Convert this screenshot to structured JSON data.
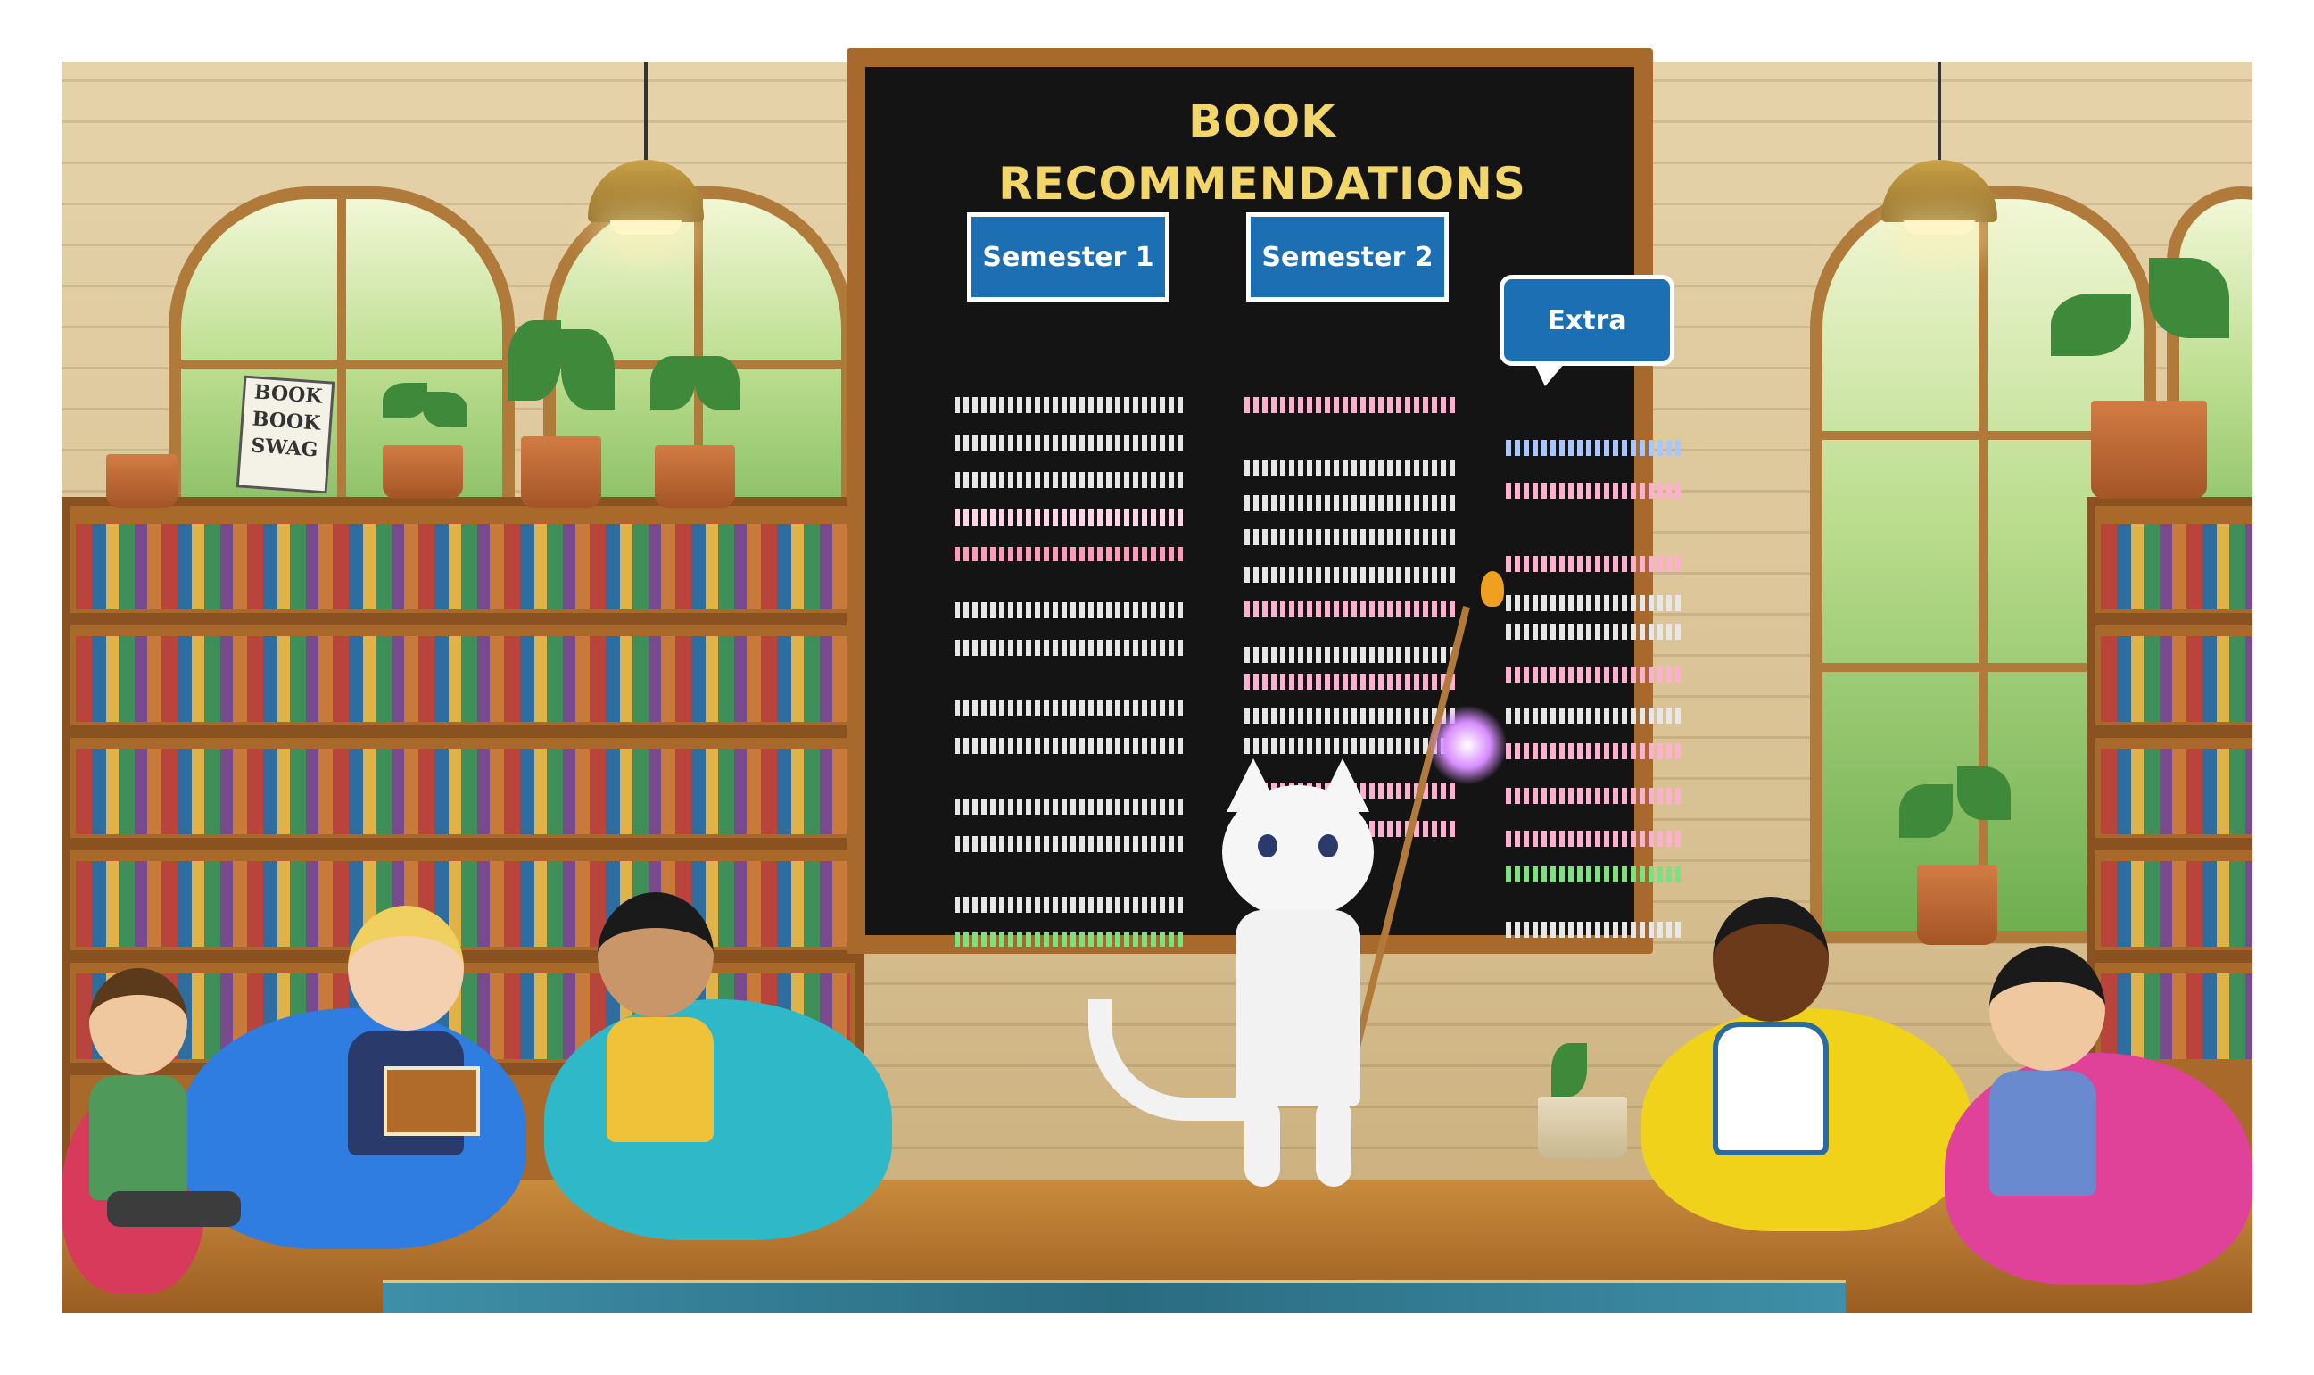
{
  "board": {
    "title": "BOOK RECOMMENDATIONS",
    "tabs": [
      {
        "label": "Semester 1"
      },
      {
        "label": "Semester 2"
      },
      {
        "label": "Extra"
      }
    ]
  },
  "sign": {
    "lines": [
      "BOOK",
      "BOOK",
      "SWAG"
    ]
  },
  "colors": {
    "board_bg": "#141414",
    "title": "#f3d66a",
    "tab_bg": "#1d6fb3",
    "tab_border": "#ffffff",
    "frame_wood": "#a86a2c"
  }
}
